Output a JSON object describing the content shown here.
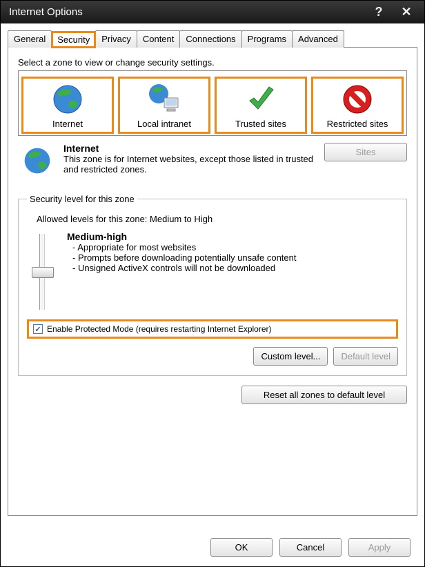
{
  "title": "Internet Options",
  "tabs": [
    "General",
    "Security",
    "Privacy",
    "Content",
    "Connections",
    "Programs",
    "Advanced"
  ],
  "active_tab": "Security",
  "zone_instruction": "Select a zone to view or change security settings.",
  "zones": [
    {
      "name": "Internet"
    },
    {
      "name": "Local intranet"
    },
    {
      "name": "Trusted sites"
    },
    {
      "name": "Restricted sites"
    }
  ],
  "selected_zone": {
    "title": "Internet",
    "description": "This zone is for Internet websites, except those listed in trusted and restricted zones."
  },
  "sites_button": "Sites",
  "fieldset_legend": "Security level for this zone",
  "allowed_levels": "Allowed levels for this zone: Medium to High",
  "level": {
    "name": "Medium-high",
    "bullets": [
      "- Appropriate for most websites",
      "- Prompts before downloading potentially unsafe content",
      "- Unsigned ActiveX controls will not be downloaded"
    ]
  },
  "protected_mode": {
    "checked": true,
    "label": "Enable Protected Mode (requires restarting Internet Explorer)"
  },
  "buttons": {
    "custom_level": "Custom level...",
    "default_level": "Default level",
    "reset": "Reset all zones to default level",
    "ok": "OK",
    "cancel": "Cancel",
    "apply": "Apply"
  }
}
